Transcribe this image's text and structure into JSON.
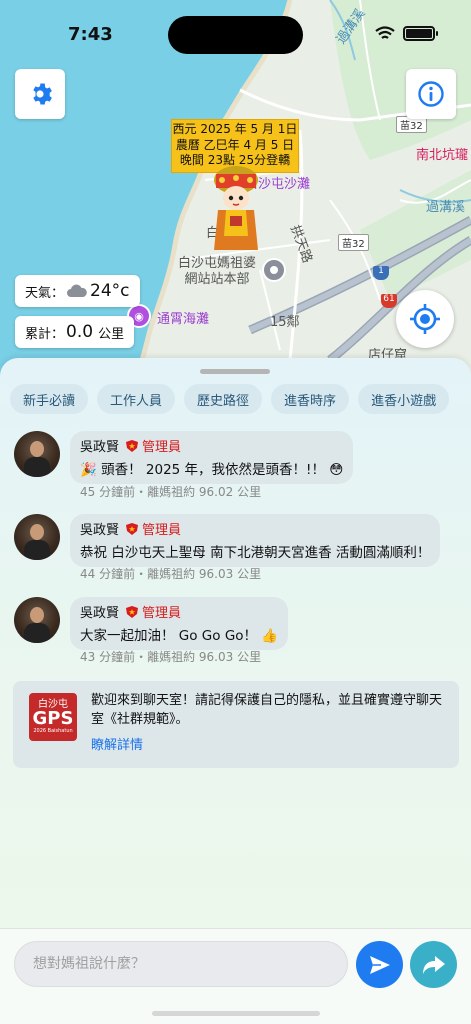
{
  "status_bar": {
    "time": "7:43"
  },
  "map": {
    "date_box": {
      "line1": "西元 2025 年 5 月 1日",
      "line2": "農曆 乙巳年 4 月 5 日",
      "line3": "晚間 23點 25分登轎"
    },
    "labels": {
      "creek_top": "過溝溪",
      "road_32": "苗32",
      "nanbei": "南北坑瓏",
      "creek_right": "過溝溪",
      "baishatun_beach": "白沙屯沙灘",
      "gongtian_road": "拱天路",
      "bai": "白沙",
      "road_32b": "苗32",
      "station": "白沙屯媽祖婆網站站本部",
      "route_1": "1",
      "route_61": "61",
      "tongxiao_beach": "通霄海灘",
      "village_15": "15鄰",
      "dianzaiku": "店仔窟"
    },
    "weather": {
      "label": "天氣：",
      "value": "24°c"
    },
    "distance": {
      "label": "累計：",
      "value": "0.0",
      "unit": "公里"
    }
  },
  "tabs": [
    "新手必讀",
    "工作人員",
    "歷史路徑",
    "進香時序",
    "進香小遊戲"
  ],
  "messages": [
    {
      "name": "吳政賢",
      "role": "管理員",
      "text": "🎉 頭香！ 2025 年，我依然是頭香！!！ 😳",
      "meta": "45 分鐘前・離媽祖約 96.02 公里"
    },
    {
      "name": "吳政賢",
      "role": "管理員",
      "text": "恭祝 白沙屯天上聖母 南下北港朝天宮進香 活動圓滿順利！",
      "meta": "44 分鐘前・離媽祖約 96.03 公里"
    },
    {
      "name": "吳政賢",
      "role": "管理員",
      "text": "大家一起加油！ Go Go Go！ 👍",
      "meta": "43 分鐘前・離媽祖約 96.03 公里"
    }
  ],
  "welcome": {
    "logo_top": "白沙屯",
    "logo_main": "GPS",
    "logo_sub": "2026 Baishatun",
    "text": "歡迎來到聊天室！請記得保護自己的隱私，並且確實遵守聊天室《社群規範》。",
    "link": "瞭解詳情"
  },
  "input": {
    "placeholder": "想對媽祖說什麼？"
  },
  "colors": {
    "accent": "#1e7cf0",
    "admin": "#d81b1b",
    "date_box": "#f6c21a",
    "share": "#3ab0c8"
  }
}
